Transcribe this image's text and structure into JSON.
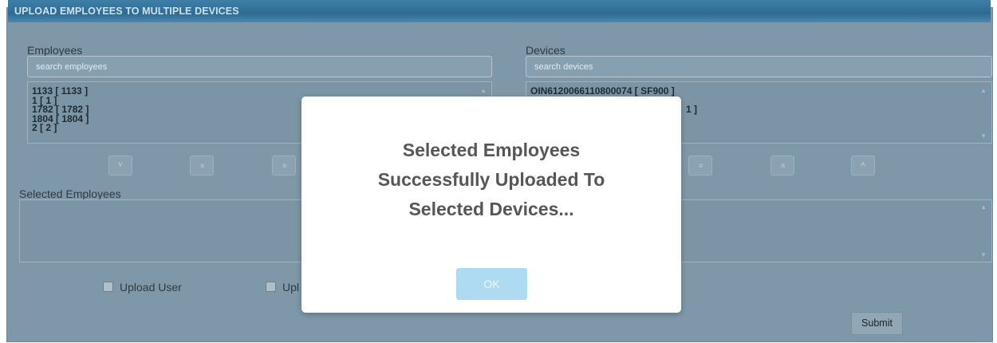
{
  "header": {
    "title": "UPLOAD EMPLOYEES TO MULTIPLE DEVICES"
  },
  "employees": {
    "label": "Employees",
    "search_placeholder": "search employees",
    "items": [
      "1133 [ 1133 ]",
      "1 [ 1 ]",
      "1782 [ 1782 ]",
      "1804 [ 1804 ]",
      "2 [ 2 ]"
    ]
  },
  "devices": {
    "label": "Devices",
    "search_placeholder": "search devices",
    "items": [
      "OIN6120066110800074 [ SF900 ]",
      "",
      "1 ]"
    ]
  },
  "arrows": {
    "down": "˅",
    "down_all": "»",
    "up_all": "«",
    "up": "˄"
  },
  "selected": {
    "label": "Selected Employees"
  },
  "options": {
    "upload_user": "Upload User",
    "upload_partial": "Upl"
  },
  "actions": {
    "submit": "Submit"
  },
  "modal": {
    "message": "Selected Employees\nSuccessfully Uploaded To\nSelected Devices...",
    "ok": "OK"
  },
  "colors": {
    "overlay_bg": "#7f98a9",
    "title_bar": "#2e6b93",
    "ok_button": "#aedbf2"
  }
}
